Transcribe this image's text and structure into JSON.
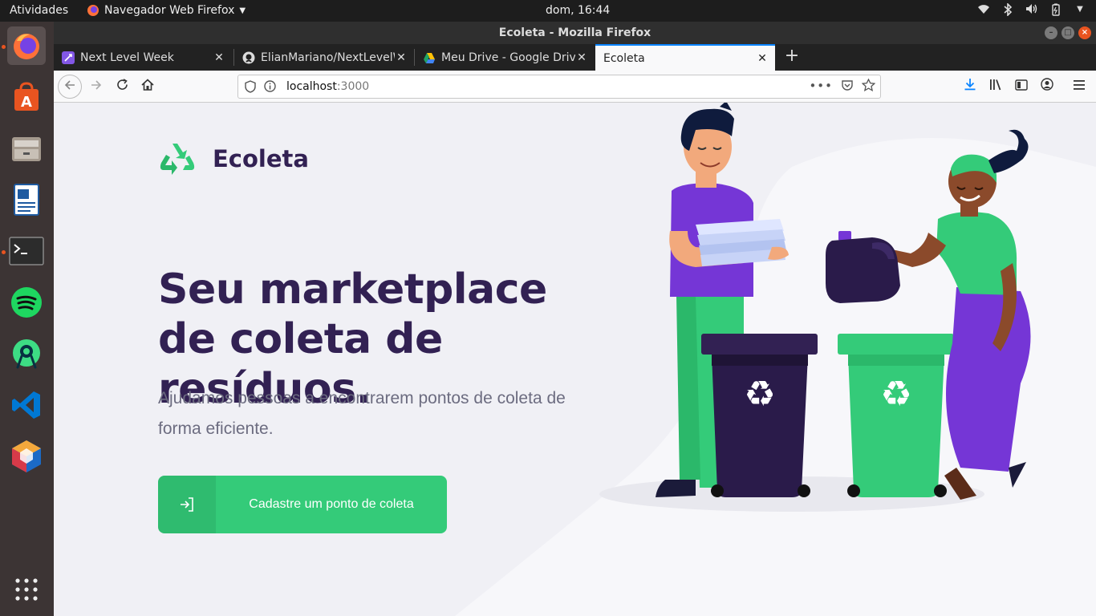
{
  "topbar": {
    "activities": "Atividades",
    "app_name": "Navegador Web Firefox",
    "clock": "dom, 16:44"
  },
  "dock": {
    "items": [
      {
        "name": "firefox-icon",
        "running": true
      },
      {
        "name": "software-center-icon",
        "running": false
      },
      {
        "name": "file-manager-icon",
        "running": false
      },
      {
        "name": "writer-icon",
        "running": false
      },
      {
        "name": "terminal-icon",
        "running": true
      },
      {
        "name": "spotify-icon",
        "running": false
      },
      {
        "name": "android-studio-icon",
        "running": false
      },
      {
        "name": "vscode-icon",
        "running": false
      },
      {
        "name": "netbeans-icon",
        "running": false
      },
      {
        "name": "apps-grid-icon",
        "running": false
      }
    ]
  },
  "window": {
    "title": "Ecoleta - Mozilla Firefox"
  },
  "tabs": [
    {
      "title": "Next Level Week",
      "icon": "rocket-icon",
      "color": "#8257e5"
    },
    {
      "title": "ElianMariano/NextLevelW",
      "icon": "github-icon",
      "color": "#333333"
    },
    {
      "title": "Meu Drive - Google Drive",
      "icon": "google-drive-icon",
      "color": "#1fa463"
    },
    {
      "title": "Ecoleta",
      "icon": "",
      "selected": true
    }
  ],
  "urlbar": {
    "host": "localhost",
    "port": ":3000"
  },
  "page": {
    "logo_text": "Ecoleta",
    "title": "Seu marketplace de coleta de resíduos.",
    "subtitle": "Ajudamos pessoas a encontrarem pontos de coleta de forma eficiente.",
    "cta_label": "Cadastre um ponto de coleta"
  },
  "colors": {
    "brand_green": "#34cb79",
    "brand_purple": "#322153",
    "text_gray": "#6c6c80",
    "background": "#f0f0f5"
  }
}
